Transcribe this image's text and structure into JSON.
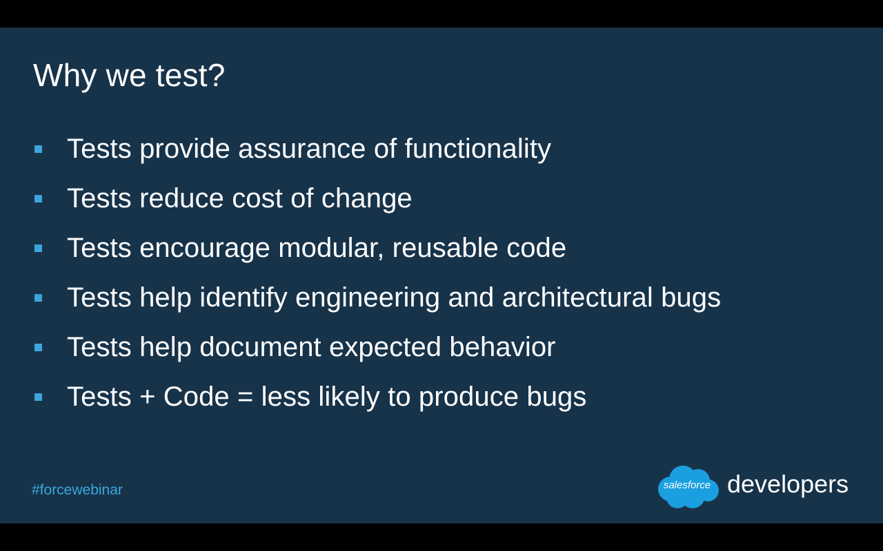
{
  "slide": {
    "title": "Why we test?",
    "bullets": [
      "Tests provide assurance of functionality",
      "Tests reduce cost of change",
      "Tests encourage modular, reusable code",
      "Tests help identify engineering and architectural bugs",
      "Tests help document expected behavior",
      "Tests + Code = less likely to produce bugs"
    ],
    "hashtag": "#forcewebinar",
    "logo": {
      "cloud_text": "salesforce",
      "wordmark": "developers"
    }
  },
  "colors": {
    "background": "#17334a",
    "accent": "#3aa6dd",
    "text": "#ffffff",
    "letterbox": "#000000"
  },
  "icons": {
    "bullet": "square-bullet-icon",
    "logo": "salesforce-cloud-logo-icon"
  }
}
